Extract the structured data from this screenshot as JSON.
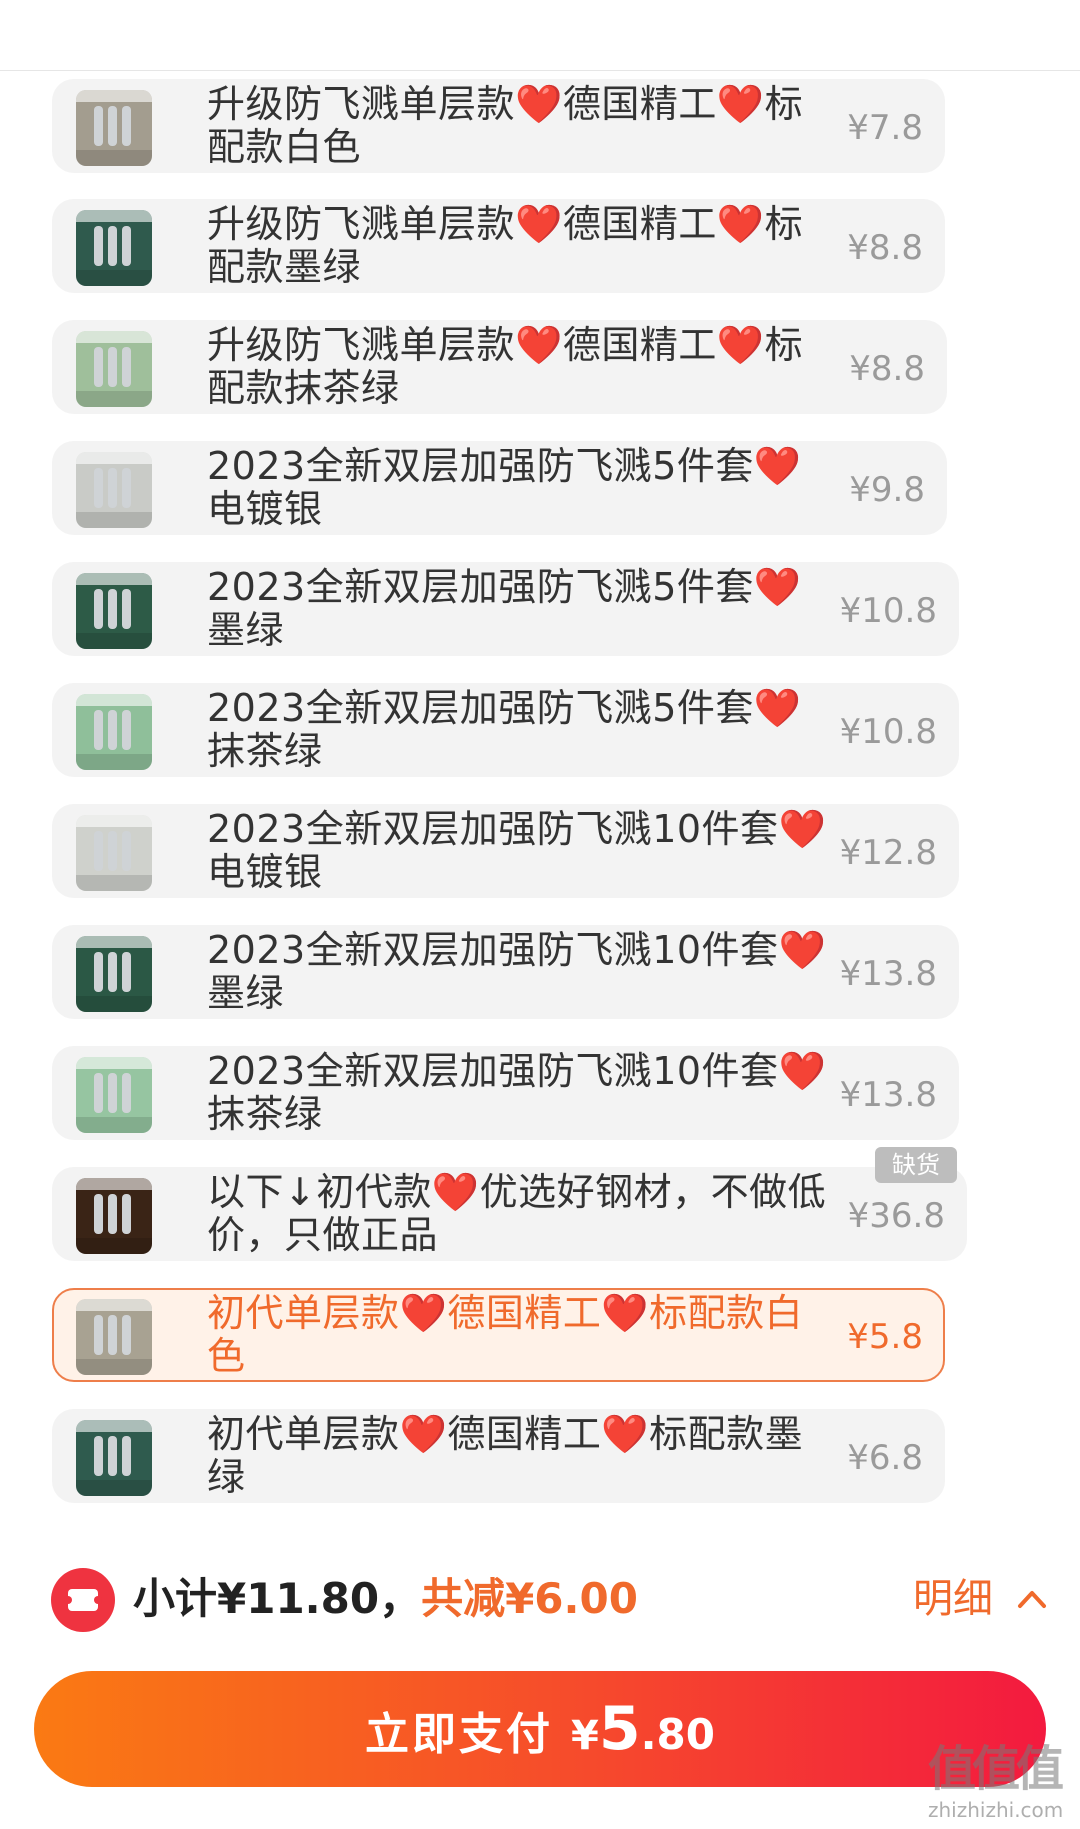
{
  "skus": [
    {
      "name": "升级防飞溅单层款❤️德国精工❤️标配款白色",
      "price": "¥7.8",
      "thumb_color": "#a39d8f",
      "selected": false
    },
    {
      "name": "升级防飞溅单层款❤️德国精工❤️标配款墨绿",
      "price": "¥8.8",
      "thumb_color": "#2f5a4d",
      "selected": false
    },
    {
      "name": "升级防飞溅单层款❤️德国精工❤️标配款抹茶绿",
      "price": "¥8.8",
      "thumb_color": "#9fbf9b",
      "selected": false
    },
    {
      "name": "2023全新双层加强防飞溅5件套❤️电镀银",
      "price": "¥9.8",
      "thumb_color": "#c9cbc7",
      "selected": false
    },
    {
      "name": "2023全新双层加强防飞溅5件套❤️墨绿",
      "price": "¥10.8",
      "thumb_color": "#2d5b47",
      "selected": false
    },
    {
      "name": "2023全新双层加强防飞溅5件套❤️抹茶绿",
      "price": "¥10.8",
      "thumb_color": "#8fbf9a",
      "selected": false
    },
    {
      "name": "2023全新双层加强防飞溅10件套❤️电镀银",
      "price": "¥12.8",
      "thumb_color": "#cfd1cc",
      "selected": false
    },
    {
      "name": "2023全新双层加强防飞溅10件套❤️墨绿",
      "price": "¥13.8",
      "thumb_color": "#2b5845",
      "selected": false
    },
    {
      "name": "2023全新双层加强防飞溅10件套❤️抹茶绿",
      "price": "¥13.8",
      "thumb_color": "#96c5a1",
      "selected": false
    },
    {
      "name": "以下↓初代款❤️优选好钢材，不做低价，只做正品",
      "price": "¥36.8",
      "thumb_color": "#3a2416",
      "selected": false
    },
    {
      "name": "初代单层款❤️德国精工❤️标配款白色",
      "price": "¥5.8",
      "thumb_color": "#a8a292",
      "selected": true
    },
    {
      "name": "初代单层款❤️德国精工❤️标配款墨绿",
      "price": "¥6.8",
      "thumb_color": "#2f5b4e",
      "selected": false
    }
  ],
  "stock_badge": "缺货",
  "summary": {
    "subtotal_text": "小计¥11.80，",
    "discount_text": "共减¥6.00",
    "detail_label": "明细"
  },
  "pay_button": {
    "label": "立即支付",
    "currency": "¥",
    "amount_int": "5",
    "amount_dec": ".80"
  },
  "watermark": {
    "main": "值值值",
    "sub": "zhizhizhi.com"
  },
  "colors": {
    "accent": "#f06a2c",
    "selected_bg": "#fff2e8",
    "badge_bg": "#bdbdbd",
    "coupon_red": "#ef3340"
  }
}
